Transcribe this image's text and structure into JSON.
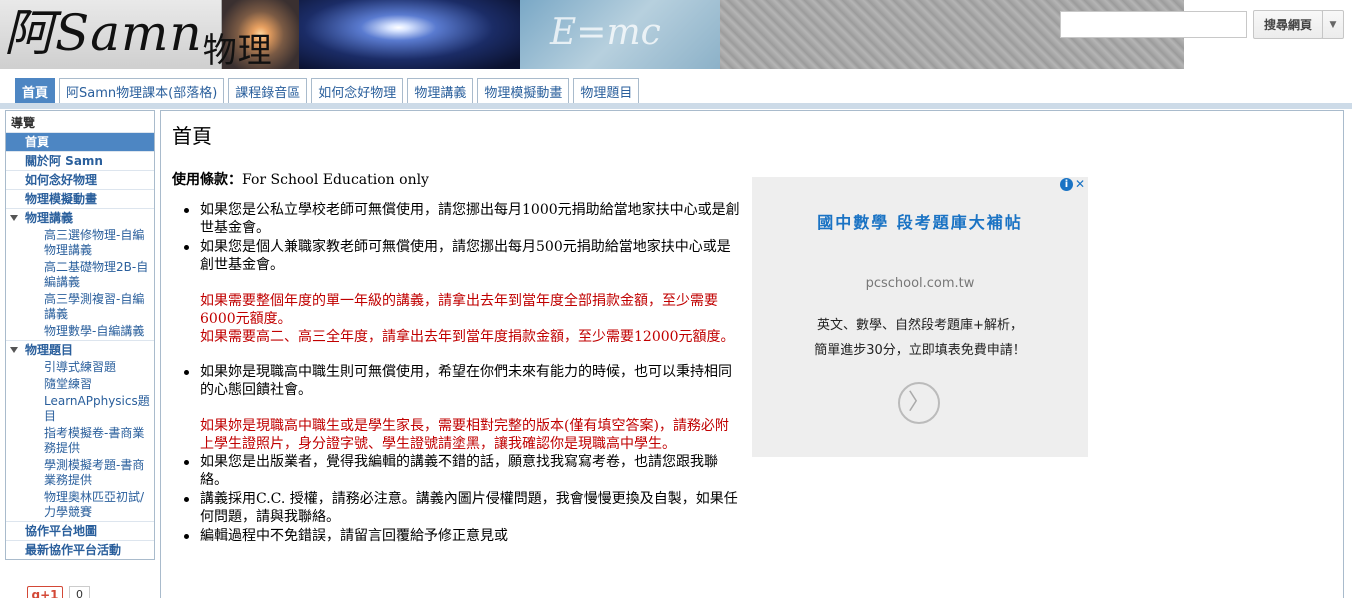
{
  "header": {
    "logo_text": "阿Samn",
    "logo_sub": "物理",
    "banner_text": "E=mc"
  },
  "search": {
    "value": "",
    "button_label": "搜尋網頁",
    "dropdown_icon": "▼"
  },
  "tabs": [
    {
      "label": "首頁",
      "active": true
    },
    {
      "label": "阿Samn物理課本(部落格)"
    },
    {
      "label": "課程錄音區"
    },
    {
      "label": "如何念好物理"
    },
    {
      "label": "物理講義"
    },
    {
      "label": "物理模擬動畫"
    },
    {
      "label": "物理題目"
    }
  ],
  "sidebar": {
    "title": "導覽",
    "items": [
      {
        "label": "首頁"
      },
      {
        "label": "關於阿 Samn"
      },
      {
        "label": "如何念好物理"
      },
      {
        "label": "物理模擬動畫"
      },
      {
        "label": "物理講義"
      },
      {
        "label": "高三選修物理-自編物理講義"
      },
      {
        "label": "高二基礎物理2B-自編講義"
      },
      {
        "label": "高三學測複習-自編講義"
      },
      {
        "label": "物理數學-自編講義"
      },
      {
        "label": "物理題目"
      },
      {
        "label": "引導式練習題"
      },
      {
        "label": "隨堂練習"
      },
      {
        "label": "LearnAPphysics題目"
      },
      {
        "label": "指考模擬卷-書商業務提供"
      },
      {
        "label": "學測模擬考題-書商業務提供"
      },
      {
        "label": "物理奧林匹亞初試/力學競賽"
      },
      {
        "label": "協作平台地圖"
      },
      {
        "label": "最新協作平台活動"
      }
    ],
    "plusone_label": "g+1",
    "plusone_count": "0"
  },
  "main": {
    "page_title": "首頁",
    "terms_label": "使用條款：",
    "terms_value": "For School Education only",
    "bullets": [
      "如果您是公私立學校老師可無償使用，請您挪出每月1000元捐助給當地家扶中心或是創世基金會。",
      "如果您是個人兼職家教老師可無償使用，請您挪出每月500元捐助給當地家扶中心或是創世基金會。",
      "如果妳是現職高中職生則可無償使用，希望在你們未來有能力的時候，也可以秉持相同的心態回饋社會。",
      "如果您是出版業者，覺得我編輯的講義不錯的話，願意找我寫寫考卷，也請您跟我聯絡。",
      "講義採用C.C. 授權，請務必注意。講義內圖片侵權問題，我會慢慢更換及自製，如果任何問題，請與我聯絡。",
      "編輯過程中不免錯誤，請留言回覆給予修正意見或"
    ],
    "red_block_1": [
      "如果需要整個年度的單一年級的講義，請拿出去年到當年度全部捐款金額，至少需要6000元額度。",
      "如果需要高二、高三全年度，請拿出去年到當年度捐款金額，至少需要12000元額度。"
    ],
    "red_block_2": "如果妳是現職高中職生或是學生家長，需要相對完整的版本(僅有填空答案)，請務必附上學生證照片，身分證字號、學生證號請塗黑，讓我確認你是現職高中學生。"
  },
  "ad": {
    "info_icon": "i",
    "close_icon": "✕",
    "title": "國中數學 段考題庫大補帖",
    "domain": "pcschool.com.tw",
    "desc_1": "英文、數學、自然段考題庫+解析，",
    "desc_2": "簡單進步30分，立即填表免費申請！",
    "arrow_icon": "〉"
  },
  "colors": {
    "accent": "#4d86c3",
    "link": "#2a5f9c",
    "warning": "#c00000",
    "ad_link": "#1a73c4"
  }
}
